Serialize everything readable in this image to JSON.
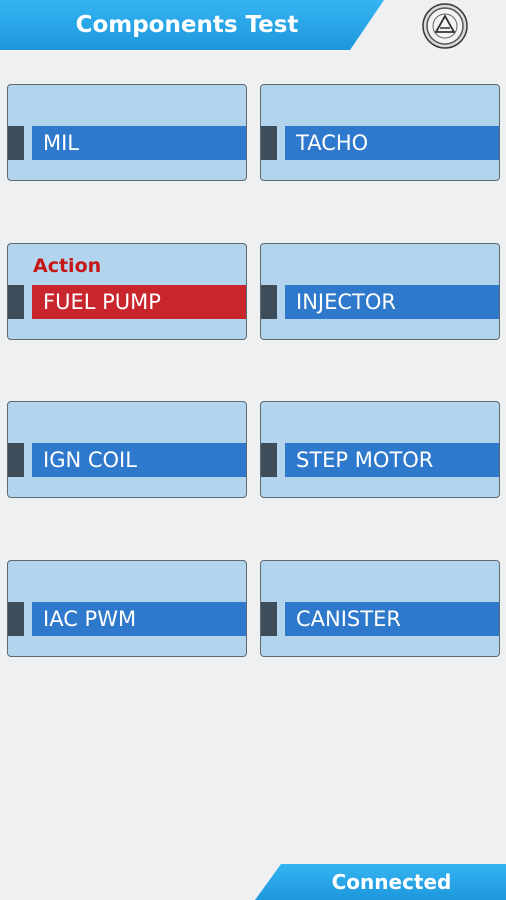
{
  "header": {
    "title": "Components Test"
  },
  "colors": {
    "header_blue": "#27a7ea",
    "tile_bg": "#b3d4ed",
    "bar_blue": "#2f79cc",
    "bar_active_red": "#c9252c",
    "action_text_red": "#c61717"
  },
  "logo": {
    "icon": "brand-emblem-icon"
  },
  "tests": [
    {
      "label": "MIL",
      "active": false
    },
    {
      "label": "TACHO",
      "active": false
    },
    {
      "label": "FUEL PUMP",
      "active": true,
      "status_text": "Action"
    },
    {
      "label": "INJECTOR",
      "active": false
    },
    {
      "label": "IGN COIL",
      "active": false
    },
    {
      "label": "STEP MOTOR",
      "active": false
    },
    {
      "label": "IAC PWM",
      "active": false
    },
    {
      "label": "CANISTER",
      "active": false
    }
  ],
  "footer": {
    "status": "Connected"
  }
}
